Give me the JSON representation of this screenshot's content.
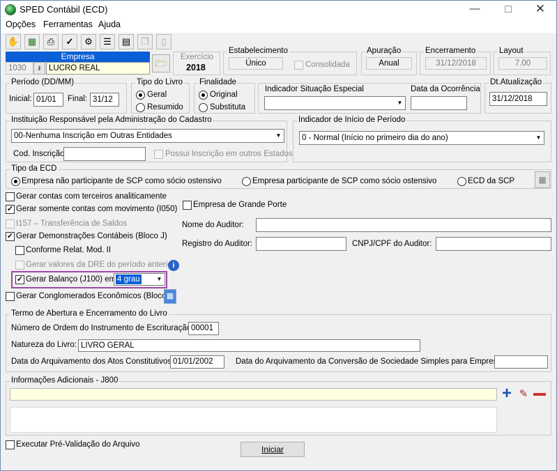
{
  "window": {
    "title": "SPED Contábil (ECD)",
    "minimize_icon": "minimize-icon",
    "maximize_icon": "maximize-icon",
    "close_icon": "close-icon"
  },
  "menu": [
    "Opções",
    "Ferramentas",
    "Ajuda"
  ],
  "toolbar": {
    "icons": [
      "hand-icon",
      "network-icon",
      "printer-icon",
      "check-icon",
      "settings-icon",
      "edit-list-icon",
      "document-icon",
      "copy-icon",
      "page-icon"
    ]
  },
  "empresa": {
    "header": "Empresa",
    "code": "1030",
    "name": "LUCRO REAL",
    "exercicio_label": "Exercício",
    "exercicio_value": "2018"
  },
  "estabelecimento": {
    "label": "Estabelecimento",
    "value": "Único",
    "consolidada_label": "Consolidada"
  },
  "apuracao": {
    "label": "Apuração",
    "value": "Anual"
  },
  "encerramento": {
    "label": "Encerramento",
    "value": "31/12/2018"
  },
  "layout": {
    "label": "Layout",
    "value": "7.00"
  },
  "periodo": {
    "label": "Período (DD/MM)",
    "inicial_label": "Inicial:",
    "inicial_value": "01/01",
    "final_label": "Final:",
    "final_value": "31/12"
  },
  "tipo_livro": {
    "label": "Tipo do Livro",
    "options": [
      "Geral",
      "Resumido"
    ],
    "selected": "Geral"
  },
  "finalidade": {
    "label": "Finalidade",
    "options": [
      "Original",
      "Substituta"
    ],
    "selected": "Original"
  },
  "situacao": {
    "indicador_label": "Indicador Situação Especial",
    "indicador_value": "",
    "data_label": "Data da Ocorrência",
    "data_value": ""
  },
  "dt_atualizacao": {
    "label": "Dt.Atualização",
    "value": "31/12/2018"
  },
  "instituicao": {
    "label": "Instituição Responsável pela Administração do Cadastro",
    "value": "00-Nenhuma Inscrição em Outras Entidades",
    "cod_label": "Cod. Inscrição",
    "cod_value": "",
    "possui_label": "Possui Inscrição em outros Estados"
  },
  "inicio_periodo": {
    "label": "Indicador de Início de Período",
    "value": "0 - Normal (Início no primeiro dia do ano)"
  },
  "tipo_ecd": {
    "label": "Tipo da ECD",
    "options": [
      "Empresa não participante de SCP como sócio ostensivo",
      "Empresa participante de SCP como sócio ostensivo",
      "ECD da SCP"
    ],
    "selected": "Empresa não participante de SCP como sócio ostensivo"
  },
  "options": {
    "gerar_terceiros": "Gerar contas com terceiros analiticamente",
    "gerar_movimento": "Gerar somente contas com movimento (I050)",
    "i157": "I157 – Transferência de Saldos",
    "demonstracoes": "Gerar Demonstrações Contábeis (Bloco J)",
    "conforme": "Conforme Relat. Mod. II",
    "dre_anterior": "Gerar valores da DRE do período anterior",
    "balanco": "Gerar Balanço (J100) em",
    "balanco_grau": "4 grau",
    "conglomerados": "Gerar Conglomerados Econômicos (Bloco K)",
    "grande_porte": "Empresa de Grande Porte"
  },
  "auditor": {
    "nome_label": "Nome do Auditor:",
    "registro_label": "Registro do Auditor:",
    "cnpj_label": "CNPJ/CPF do Auditor:"
  },
  "termo": {
    "label": "Termo de Abertura e Encerramento do Livro",
    "ordem_label": "Número de Ordem do Instrumento de Escrituração:",
    "ordem_value": "00001",
    "natureza_label": "Natureza do Livro:",
    "natureza_value": "LIVRO GERAL",
    "arquivamento_label": "Data do Arquivamento dos Atos Constitutivos:",
    "arquivamento_value": "01/01/2002",
    "conversao_label": "Data do Arquivamento da Conversão de Sociedade Simples para Empresária:",
    "conversao_value": ""
  },
  "info_adicionais": {
    "label": "Informações Adicionais - J800"
  },
  "pre_validacao": "Executar Pré-Validação do Arquivo",
  "iniciar": "Iniciar"
}
